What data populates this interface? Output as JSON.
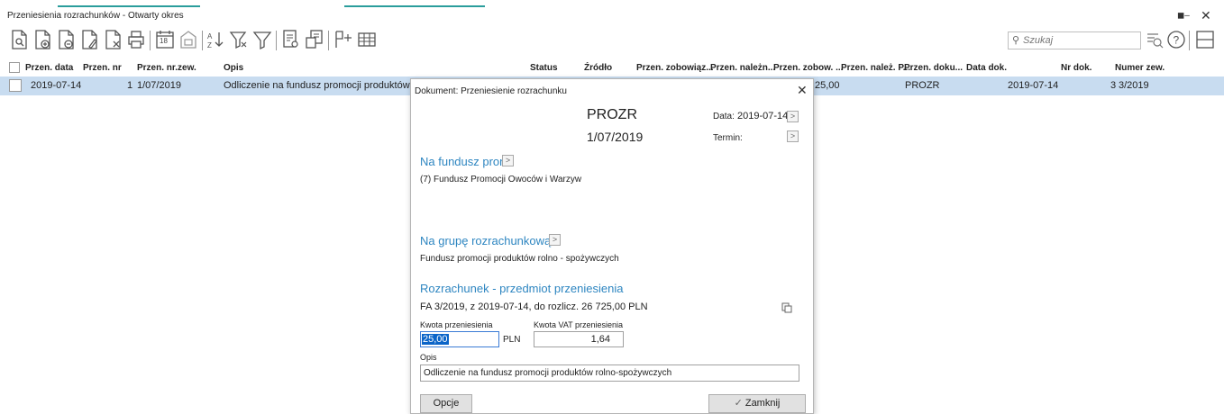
{
  "window": {
    "title": "Przeniesienia rozrachunków - Otwarty okres",
    "accent_color": "#2a9d9c"
  },
  "toolbar": {
    "icons": [
      "new-document-icon",
      "add-document-icon",
      "copy-document-icon",
      "edit-document-icon",
      "delete-document-icon",
      "print-icon",
      "calendar-icon",
      "archive-icon",
      "sort-az-icon",
      "filter-clear-icon",
      "filter-icon",
      "preview-icon",
      "export-icon",
      "columns-icon",
      "grid-icon"
    ],
    "calendar_day": "18",
    "search_placeholder": "Szukaj"
  },
  "grid": {
    "columns": [
      "Przen. data",
      "Przen. nr",
      "Przen. nr.zew.",
      "Opis",
      "Status",
      "Źródło",
      "Przen. zobowiąz...",
      "Przen. należn...",
      "Przen. zobow. ...",
      "Przen. należ. P...",
      "Przen. doku...",
      "Data dok.",
      "Nr dok.",
      "Numer zew."
    ],
    "rows": [
      {
        "date": "2019-07-14",
        "nr": "1",
        "nr_zew": "1/07/2019",
        "opis": "Odliczenie na fundusz promocji produktów r",
        "przen_zobow": "25,00",
        "przen_doku": "PROZR",
        "data_dok": "2019-07-14",
        "nr_dok": "3",
        "numer_zew": "3/2019"
      }
    ]
  },
  "dialog": {
    "title": "Dokument: Przeniesienie rozrachunku",
    "doc_type": "PROZR",
    "doc_number": "1/07/2019",
    "date_label": "Data:",
    "date_value": "2019-07-14",
    "term_label": "Termin:",
    "fund_heading": "Na fundusz pron",
    "fund_value": "(7) Fundusz Promocji Owoców i Warzyw",
    "group_heading": "Na grupę rozrachunkową:",
    "group_value": "Fundusz promocji produktów rolno - spożywczych",
    "settlement_heading": "Rozrachunek - przedmiot przeniesienia",
    "settlement_value": "FA 3/2019, z 2019-07-14, do rozlicz. 26 725,00 PLN",
    "amount_label": "Kwota przeniesienia",
    "amount_value": "25,00",
    "amount_currency": "PLN",
    "vat_label": "Kwota VAT przeniesienia",
    "vat_value": "1,64",
    "desc_label": "Opis",
    "desc_value": "Odliczenie na fundusz promocji produktów rolno-spożywczych",
    "options_button": "Opcje",
    "close_button": "Zamknij"
  }
}
